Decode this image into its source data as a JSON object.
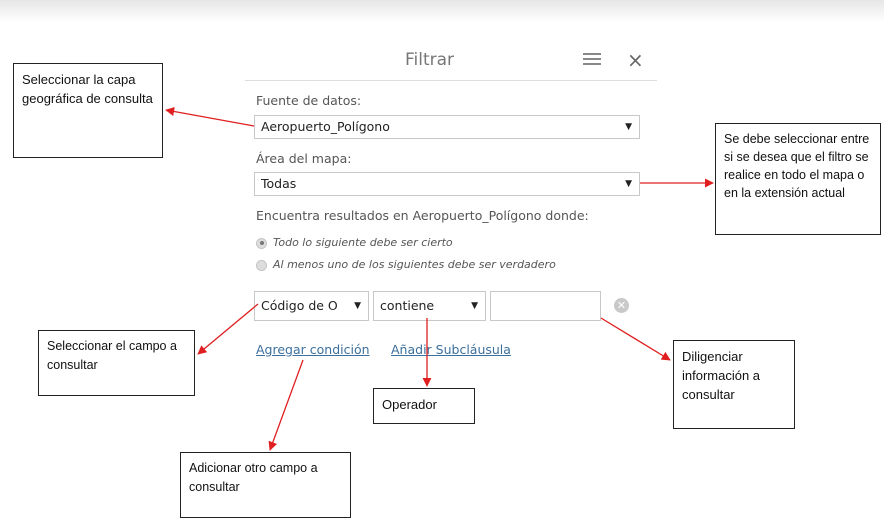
{
  "panel": {
    "title": "Filtrar",
    "menu_icon": "hamburger-menu-icon",
    "close_icon": "close-icon",
    "close_glyph": "×"
  },
  "filter": {
    "data_source_label": "Fuente de datos:",
    "data_source_value": "Aeropuerto_Polígono",
    "map_area_label": "Área del mapa:",
    "map_area_value": "Todas",
    "results_text": "Encuentra resultados en Aeropuerto_Polígono donde:",
    "radio_options": [
      {
        "label": "Todo lo siguiente debe ser cierto",
        "checked": true
      },
      {
        "label": "Al menos uno de los siguientes debe ser verdadero",
        "checked": false
      }
    ],
    "condition": {
      "field_value": "Código de O",
      "operator_value": "contiene",
      "input_value": ""
    },
    "add_condition_link": "Agregar condición",
    "add_subclause_link": "Añadir Subcláusula"
  },
  "annotations": {
    "layer": "Seleccionar la capa geográfica de consulta",
    "extent": "Se debe seleccionar entre si se desea que el filtro se realice en todo el mapa o en la extensión actual",
    "field": "Seleccionar el campo a consultar",
    "operator": "Operador",
    "value": "Diligenciar información a consultar",
    "add_field": "Adicionar otro campo a consultar"
  },
  "colors": {
    "arrow": "#e02020",
    "link": "#3b6f9e"
  }
}
